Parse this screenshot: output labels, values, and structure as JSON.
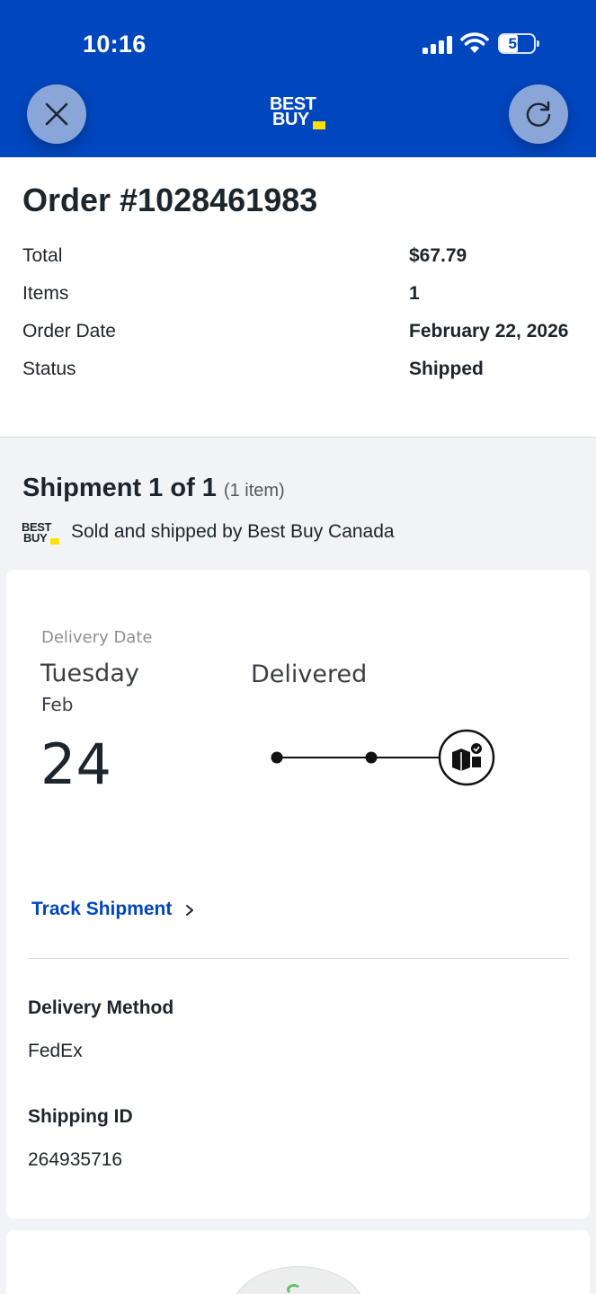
{
  "status_bar": {
    "time": "10:16",
    "battery": "50"
  },
  "header": {
    "logo_line1": "BEST",
    "logo_line2": "BUY",
    "close_icon": "close-icon",
    "refresh_icon": "refresh-icon",
    "brand_color": "#0046be",
    "tag_color": "#ffe000"
  },
  "order": {
    "title": "Order #1028461983",
    "rows": [
      {
        "label": "Total",
        "value": "$67.79"
      },
      {
        "label": "Items",
        "value": "1"
      },
      {
        "label": "Order Date",
        "value": "February 22, 2026"
      },
      {
        "label": "Status",
        "value": "Shipped"
      }
    ]
  },
  "shipment": {
    "title": "Shipment 1 of 1",
    "count": "(1 item)",
    "seller_logo_line1": "BEST",
    "seller_logo_line2": "BUY",
    "seller": "Sold and shipped by Best Buy Canada",
    "delivery_date_label": "Delivery Date",
    "day": "Tuesday",
    "month": "Feb",
    "date": "24",
    "delivery_status": "Delivered",
    "track_label": "Track Shipment",
    "delivery_method_label": "Delivery Method",
    "delivery_method": "FedEx",
    "shipping_id_label": "Shipping ID",
    "shipping_id": "264935716"
  }
}
